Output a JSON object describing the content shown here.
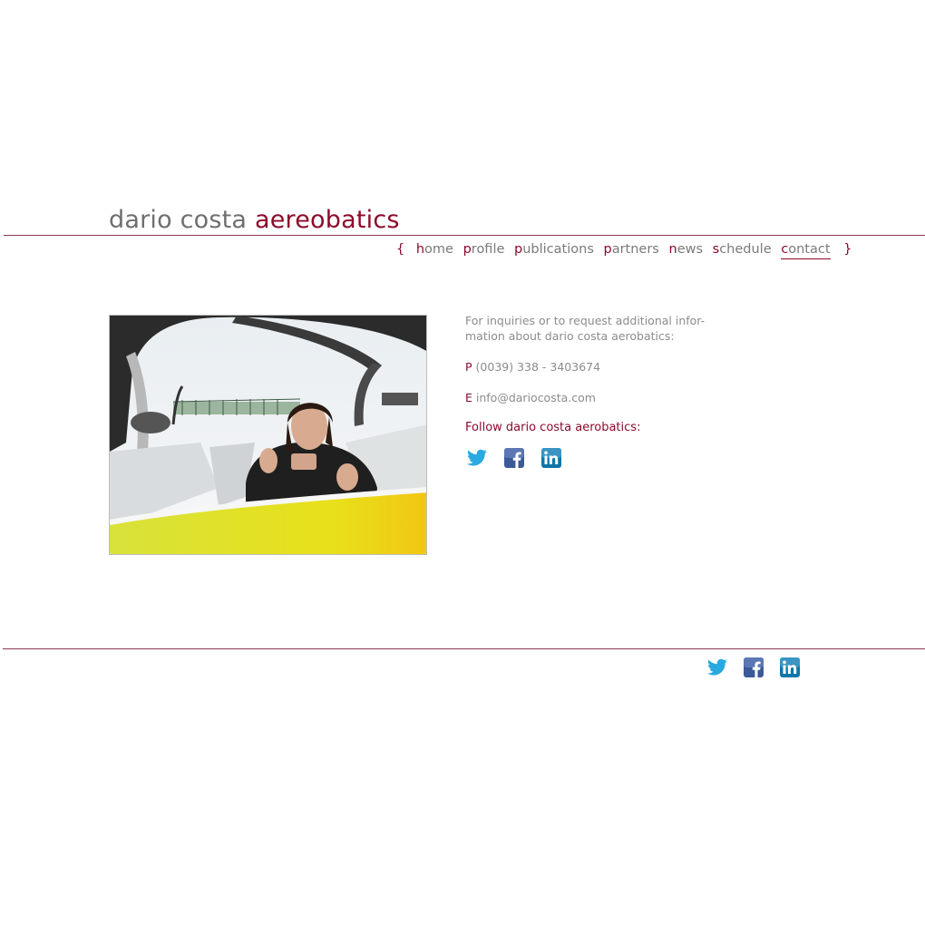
{
  "logo": {
    "part1": "dario costa",
    "part2": "aereobatics"
  },
  "nav": {
    "open_brace": "{",
    "close_brace": "}",
    "items": [
      {
        "initial": "h",
        "rest": "ome"
      },
      {
        "initial": "p",
        "rest": "rofile"
      },
      {
        "initial": "p",
        "rest": "ublications"
      },
      {
        "initial": "p",
        "rest": "artners"
      },
      {
        "initial": "n",
        "rest": "ews"
      },
      {
        "initial": "s",
        "rest": "chedule"
      },
      {
        "initial": "c",
        "rest": "ontact"
      }
    ],
    "active": "contact"
  },
  "contact": {
    "intro_line1": "For inquiries or to request additional infor-",
    "intro_line2": "mation about dario costa aerobatics:",
    "phone_label": "P",
    "phone": "(0039) 338 - 3403674",
    "email_label": "E",
    "email": "info@dariocosta.com",
    "follow": "Follow dario costa aerobatics:"
  },
  "social": {
    "icons": [
      "twitter-icon",
      "facebook-icon",
      "linkedin-icon"
    ],
    "colors": {
      "twitter": "#29a9e1",
      "facebook": "#3b5b98",
      "linkedin": "#0e76a8"
    }
  },
  "colors": {
    "accent": "#8c0a2a",
    "text_grey": "#8c8c8c",
    "rule": "#8c3a55"
  }
}
